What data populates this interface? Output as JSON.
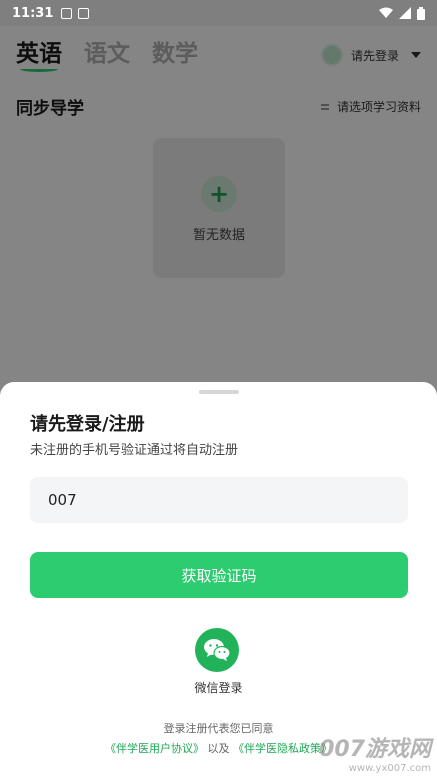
{
  "status_bar": {
    "time": "11:31"
  },
  "header": {
    "subjects": [
      "英语",
      "语文",
      "数学"
    ],
    "login_prompt": "请先登录"
  },
  "content": {
    "section_title": "同步导学",
    "select_material": "请选项学习资料",
    "empty_text": "暂无数据",
    "add_symbol": "+"
  },
  "sheet": {
    "title": "请先登录/注册",
    "subtitle": "未注册的手机号验证通过将自动注册",
    "phone_value": "007",
    "code_button": "获取验证码",
    "wechat_label": "微信登录",
    "agree_text": "登录注册代表您已同意",
    "user_agreement": "《伴学医用户协议》",
    "and_text": "以及",
    "privacy_policy": "《伴学医隐私政策》"
  },
  "colors": {
    "accent": "#2ecc71",
    "wechat": "#22b35a"
  },
  "watermark": {
    "big": "007游戏网",
    "small": "www.yx007.com"
  }
}
